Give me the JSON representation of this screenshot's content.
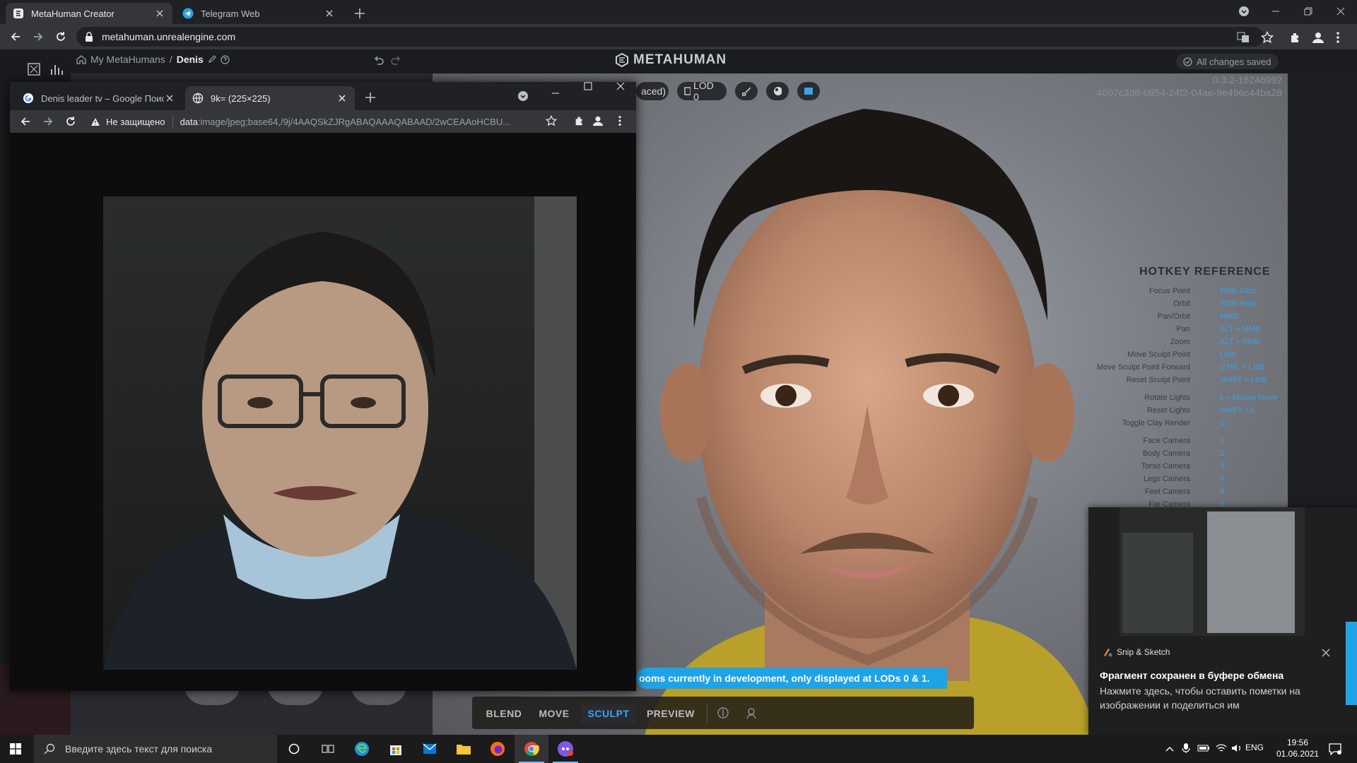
{
  "browser": {
    "tabs": [
      {
        "title": "MetaHuman Creator",
        "active": true
      },
      {
        "title": "Telegram Web",
        "active": false
      }
    ],
    "url": "metahuman.unrealengine.com"
  },
  "app": {
    "breadcrumb": {
      "root": "My MetaHumans",
      "separator": "/",
      "current": "Denis"
    },
    "logo": "METAHUMAN",
    "saved_status": "All changes saved",
    "version": "0.3.2-16246992",
    "build_id": "4607c3d6-0854-24f2-04ae-9e496c44ba28",
    "viewport_buttons": {
      "render_quality_partial": "aced)",
      "lod": "LOD 0"
    },
    "hotkeys": {
      "title": "HOTKEY REFERENCE",
      "rows": [
        {
          "label": "Focus Point",
          "key": "RMB Click"
        },
        {
          "label": "Orbit",
          "key": "RMB Hold"
        },
        {
          "label": "Pan/Orbit",
          "key": "MMB"
        },
        {
          "label": "Pan",
          "key": "ALT + MMB"
        },
        {
          "label": "Zoom",
          "key": "ALT + RMB"
        },
        {
          "label": "Move Sculpt Point",
          "key": "LMB"
        },
        {
          "label": "Move Sculpt Point Forward",
          "key": "CTRL + LMB"
        },
        {
          "label": "Reset Sculpt Point",
          "key": "SHIFT + LMB"
        },
        {
          "label": "Rotate Lights",
          "key": "L + Mouse Move"
        },
        {
          "label": "Reset Lights",
          "key": "SHIFT + L"
        },
        {
          "label": "Toggle Clay Render",
          "key": "C"
        },
        {
          "label": "Face Camera",
          "key": "1"
        },
        {
          "label": "Body Camera",
          "key": "2"
        },
        {
          "label": "Torso Camera",
          "key": "3"
        },
        {
          "label": "Legs Camera",
          "key": "4"
        },
        {
          "label": "Feet Camera",
          "key": "5"
        },
        {
          "label": "Far Camera",
          "key": "6"
        }
      ]
    },
    "dev_banner": "ooms currently in development, only displayed at LODs 0 & 1.",
    "modes": [
      "BLEND",
      "MOVE",
      "SCULPT",
      "PREVIEW"
    ],
    "active_mode": "SCULPT"
  },
  "popup": {
    "tabs": [
      {
        "title": "Denis leader tv – Google Поиск",
        "active": false
      },
      {
        "title": "9k= (225×225)",
        "active": true
      }
    ],
    "security_label": "Не защищено",
    "url_scheme": "data",
    "url_rest": ":image/jpeg;base64,/9j/4AAQSkZJRgABAQAAAQABAAD/2wCEAAoHCBU..."
  },
  "notification": {
    "app": "Snip & Sketch",
    "title": "Фрагмент сохранен в буфере обмена",
    "body": "Нажмите здесь, чтобы оставить пометки на изображении и поделиться им"
  },
  "taskbar": {
    "search_placeholder": "Введите здесь текст для поиска",
    "language": "ENG",
    "time": "19:56",
    "date": "01.06.2021"
  },
  "colors": {
    "accent": "#3ba4f0",
    "banner": "#1ea3e6"
  }
}
